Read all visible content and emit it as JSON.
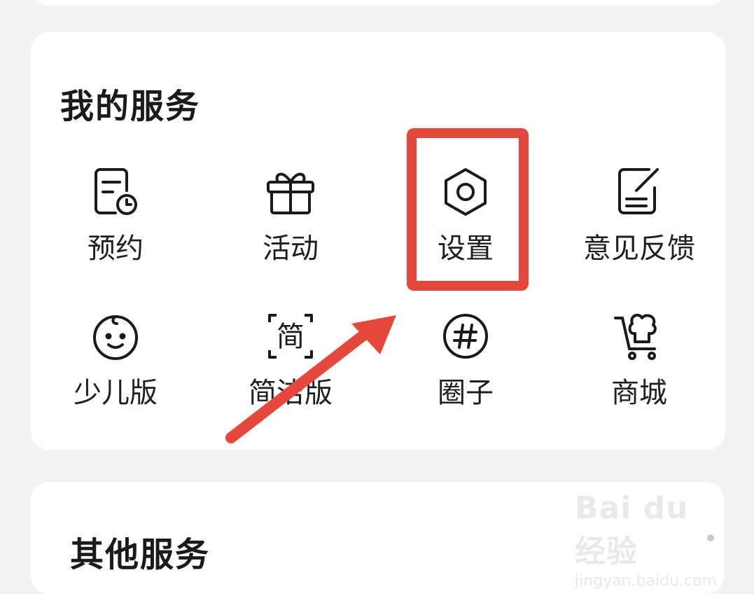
{
  "sections": {
    "my_services": {
      "title": "我的服务",
      "items": [
        {
          "label": "预约",
          "icon": "reservation-icon"
        },
        {
          "label": "活动",
          "icon": "gift-icon"
        },
        {
          "label": "设置",
          "icon": "settings-hexagon-icon"
        },
        {
          "label": "意见反馈",
          "icon": "feedback-edit-icon"
        },
        {
          "label": "少儿版",
          "icon": "baby-face-icon"
        },
        {
          "label": "简洁版",
          "icon": "simple-mode-icon"
        },
        {
          "label": "圈子",
          "icon": "hashtag-circle-icon"
        },
        {
          "label": "商城",
          "icon": "shopping-cart-icon"
        }
      ]
    },
    "other_services": {
      "title": "其他服务"
    }
  },
  "annotation": {
    "highlight_color": "#e5473a",
    "target": "设置"
  },
  "watermark": {
    "logo": "Bai du 经验",
    "url": "jingyan.baidu.com"
  },
  "colors": {
    "background": "#f3f3f3",
    "card": "#ffffff",
    "text": "#1a1a1a"
  }
}
